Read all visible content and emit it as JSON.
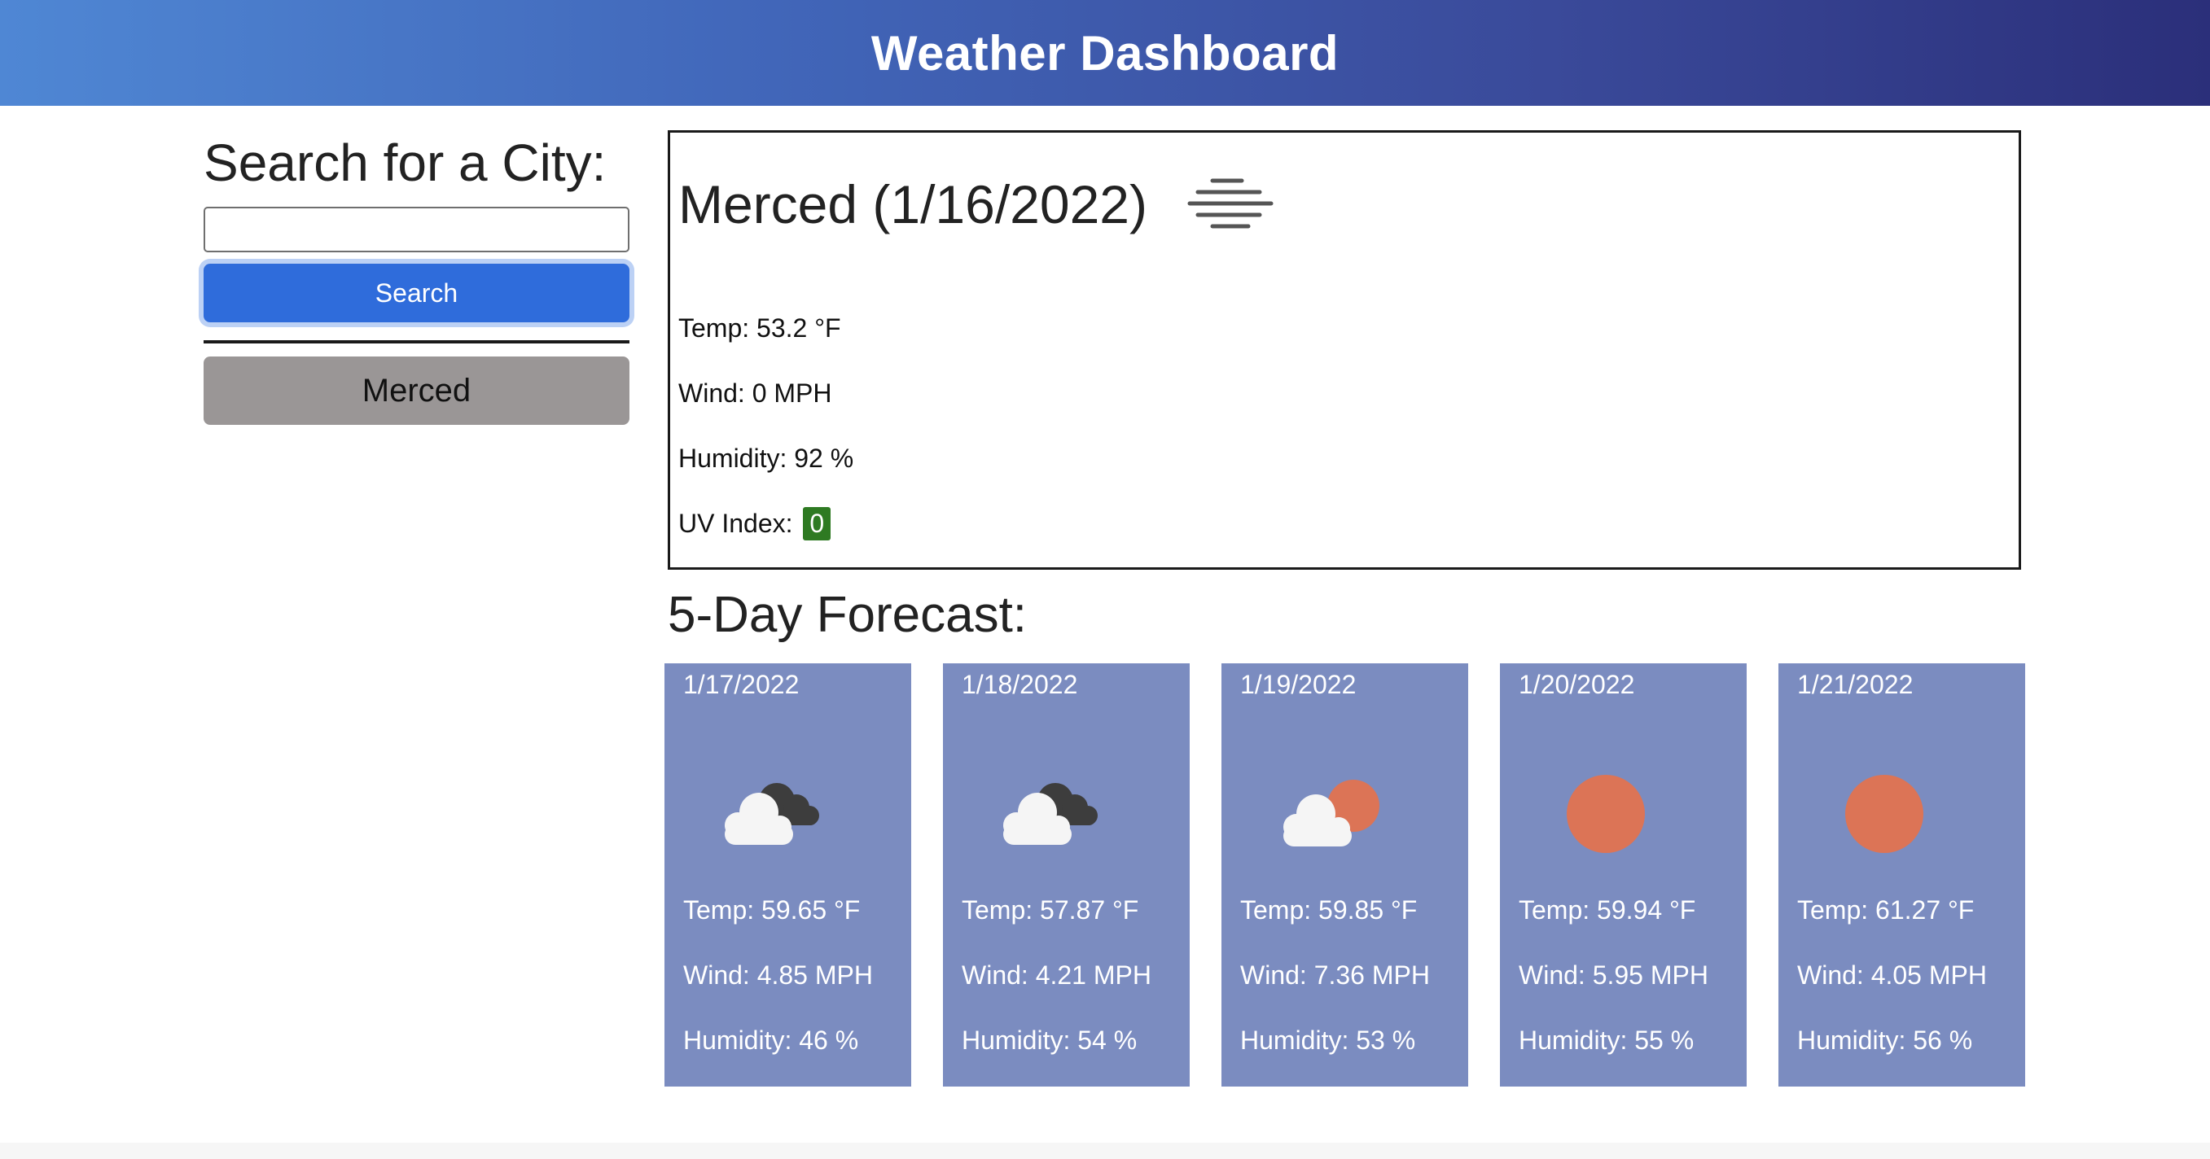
{
  "header": {
    "title": "Weather Dashboard"
  },
  "sidebar": {
    "title": "Search for a City:",
    "search_value": "",
    "search_button": "Search",
    "history": [
      "Merced"
    ]
  },
  "current": {
    "heading": "Merced (1/16/2022)",
    "icon": "mist-icon",
    "temp": "Temp: 53.2 °F",
    "wind": "Wind: 0 MPH",
    "humidity": "Humidity: 92 %",
    "uv_label": "UV Index:",
    "uv_value": "0",
    "uv_color": "#2e7a22"
  },
  "forecast": {
    "title": "5-Day Forecast:",
    "days": [
      {
        "date": "1/17/2022",
        "icon": "broken-clouds-icon",
        "temp": "Temp: 59.65 °F",
        "wind": "Wind: 4.85 MPH",
        "humidity": "Humidity: 46 %"
      },
      {
        "date": "1/18/2022",
        "icon": "broken-clouds-icon",
        "temp": "Temp: 57.87 °F",
        "wind": "Wind: 4.21 MPH",
        "humidity": "Humidity: 54 %"
      },
      {
        "date": "1/19/2022",
        "icon": "few-clouds-icon",
        "temp": "Temp: 59.85 °F",
        "wind": "Wind: 7.36 MPH",
        "humidity": "Humidity: 53 %"
      },
      {
        "date": "1/20/2022",
        "icon": "clear-sky-icon",
        "temp": "Temp: 59.94 °F",
        "wind": "Wind: 5.95 MPH",
        "humidity": "Humidity: 55 %"
      },
      {
        "date": "1/21/2022",
        "icon": "clear-sky-icon",
        "temp": "Temp: 61.27 °F",
        "wind": "Wind: 4.05 MPH",
        "humidity": "Humidity: 56 %"
      }
    ]
  },
  "colors": {
    "card_bg": "#7b8cc0",
    "search_button": "#2f6cdb",
    "history_button": "#9a9696",
    "sun": "#dc7456"
  }
}
